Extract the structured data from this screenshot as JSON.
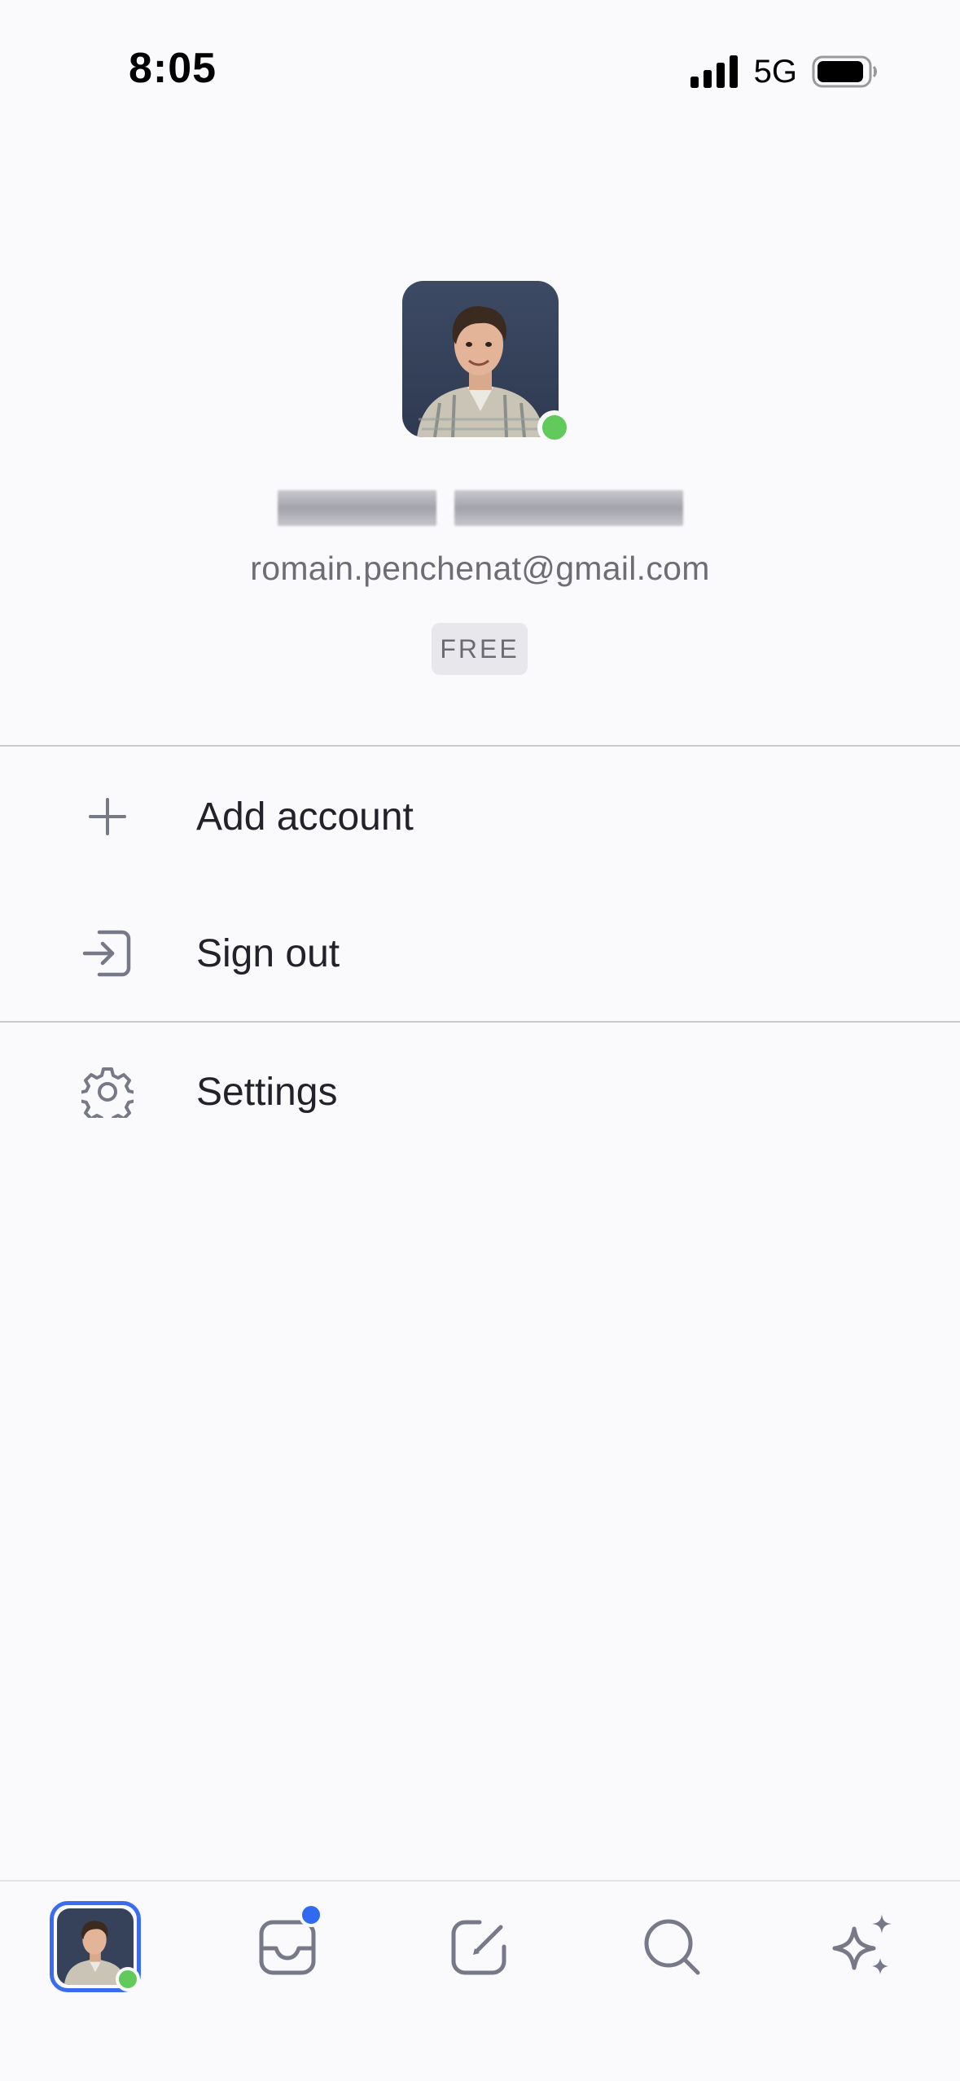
{
  "status_bar": {
    "time": "8:05",
    "network": "5G",
    "icons": [
      "cellular-signal-icon",
      "battery-icon"
    ]
  },
  "profile": {
    "avatar": "profile-photo",
    "presence": "online",
    "name_redacted": true,
    "email": "romain.penchenat@gmail.com",
    "plan": "FREE"
  },
  "menu": {
    "items": [
      {
        "icon": "plus-icon",
        "label": "Add account"
      },
      {
        "icon": "sign-out-icon",
        "label": "Sign out"
      },
      {
        "icon": "gear-icon",
        "label": "Settings"
      }
    ]
  },
  "tabbar": {
    "tabs": [
      {
        "icon": "account-avatar-icon",
        "selected": true
      },
      {
        "icon": "inbox-icon",
        "has_notification": true
      },
      {
        "icon": "compose-icon"
      },
      {
        "icon": "search-icon"
      },
      {
        "icon": "sparkles-ai-icon"
      }
    ]
  },
  "colors": {
    "background": "#fafafd",
    "accent": "#3b6cf0",
    "presence": "#62c95b",
    "icon_gray": "#777888"
  }
}
